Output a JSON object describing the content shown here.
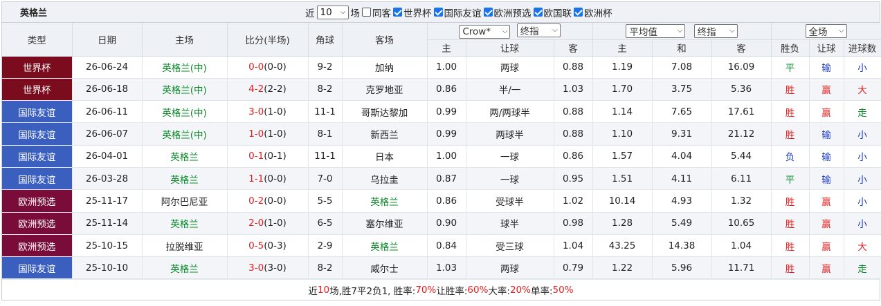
{
  "team_title": "英格兰",
  "filters": {
    "near_label": "近",
    "count_value": "10",
    "unit_label": "场",
    "same_guest": {
      "label": "同客",
      "checked": false
    },
    "comps": [
      {
        "label": "世界杯",
        "checked": true
      },
      {
        "label": "国际友谊",
        "checked": true
      },
      {
        "label": "欧洲预选",
        "checked": true
      },
      {
        "label": "欧国联",
        "checked": true
      },
      {
        "label": "欧洲杯",
        "checked": true
      }
    ]
  },
  "header": {
    "type": "类型",
    "date": "日期",
    "home": "主场",
    "score": "比分(半场)",
    "corner": "角球",
    "away": "客场",
    "company_select": "Crow*",
    "handicap_select1": "终指",
    "avg_select": "平均值",
    "handicap_select2": "终指",
    "scope_select": "全场",
    "sub": {
      "h_home": "主",
      "h_line": "让球",
      "h_away": "客",
      "e_home": "主",
      "e_draw": "和",
      "e_away": "客",
      "r_wl": "胜负",
      "r_hcp": "让球",
      "r_goals": "进球数"
    }
  },
  "colors": {
    "world_cup": "#7a0c1e",
    "friendly": "#3a5fbf",
    "euro_qual": "#7a0c3a"
  },
  "rows": [
    {
      "league": "世界杯",
      "lc": "#7a0c1e",
      "date": "26-06-24",
      "home": "英格兰(中)",
      "home_hl": true,
      "score": "0-0",
      "half": "(0-0)",
      "corner": "9-2",
      "away": "加纳",
      "away_hl": false,
      "h1": "1.00",
      "line": "两球",
      "h2": "0.88",
      "e1": "1.19",
      "e2": "7.08",
      "e3": "16.09",
      "wl": "平",
      "hcp": "输",
      "goals": "小"
    },
    {
      "league": "世界杯",
      "lc": "#7a0c1e",
      "date": "26-06-18",
      "home": "英格兰(中)",
      "home_hl": true,
      "score": "4-2",
      "half": "(2-2)",
      "corner": "8-2",
      "away": "克罗地亚",
      "away_hl": false,
      "h1": "0.86",
      "line": "半/一",
      "h2": "1.03",
      "e1": "1.70",
      "e2": "3.75",
      "e3": "5.36",
      "wl": "胜",
      "hcp": "赢",
      "goals": "大"
    },
    {
      "league": "国际友谊",
      "lc": "#3a5fbf",
      "date": "26-06-11",
      "home": "英格兰(中)",
      "home_hl": true,
      "score": "3-0",
      "half": "(1-0)",
      "corner": "11-1",
      "away": "哥斯达黎加",
      "away_hl": false,
      "h1": "0.99",
      "line": "两/两球半",
      "h2": "0.88",
      "e1": "1.14",
      "e2": "7.65",
      "e3": "17.61",
      "wl": "胜",
      "hcp": "赢",
      "goals": "走"
    },
    {
      "league": "国际友谊",
      "lc": "#3a5fbf",
      "date": "26-06-07",
      "home": "英格兰(中)",
      "home_hl": true,
      "score": "1-0",
      "half": "(1-0)",
      "corner": "8-1",
      "away": "新西兰",
      "away_hl": false,
      "h1": "0.99",
      "line": "两球半",
      "h2": "0.88",
      "e1": "1.10",
      "e2": "9.31",
      "e3": "21.12",
      "wl": "胜",
      "hcp": "输",
      "goals": "小"
    },
    {
      "league": "国际友谊",
      "lc": "#3a5fbf",
      "date": "26-04-01",
      "home": "英格兰",
      "home_hl": true,
      "score": "0-1",
      "half": "(0-1)",
      "corner": "11-1",
      "away": "日本",
      "away_hl": false,
      "h1": "1.00",
      "line": "一球",
      "h2": "0.86",
      "e1": "1.57",
      "e2": "4.04",
      "e3": "5.44",
      "wl": "负",
      "hcp": "输",
      "goals": "小"
    },
    {
      "league": "国际友谊",
      "lc": "#3a5fbf",
      "date": "26-03-28",
      "home": "英格兰",
      "home_hl": true,
      "score": "1-1",
      "half": "(0-0)",
      "corner": "7-0",
      "away": "乌拉圭",
      "away_hl": false,
      "h1": "0.87",
      "line": "一球",
      "h2": "0.95",
      "e1": "1.51",
      "e2": "4.11",
      "e3": "6.11",
      "wl": "平",
      "hcp": "输",
      "goals": "小"
    },
    {
      "league": "欧洲预选",
      "lc": "#7a0c3a",
      "date": "25-11-17",
      "home": "阿尔巴尼亚",
      "home_hl": false,
      "score": "0-2",
      "half": "(0-0)",
      "corner": "5-5",
      "away": "英格兰",
      "away_hl": true,
      "h1": "0.86",
      "line": "受球半",
      "h2": "1.02",
      "e1": "10.14",
      "e2": "4.93",
      "e3": "1.32",
      "wl": "胜",
      "hcp": "赢",
      "goals": "小"
    },
    {
      "league": "欧洲预选",
      "lc": "#7a0c3a",
      "date": "25-11-14",
      "home": "英格兰",
      "home_hl": true,
      "score": "2-0",
      "half": "(1-0)",
      "corner": "6-5",
      "away": "塞尔维亚",
      "away_hl": false,
      "h1": "0.90",
      "line": "球半",
      "h2": "0.98",
      "e1": "1.28",
      "e2": "5.49",
      "e3": "10.65",
      "wl": "胜",
      "hcp": "赢",
      "goals": "小"
    },
    {
      "league": "欧洲预选",
      "lc": "#7a0c3a",
      "date": "25-10-15",
      "home": "拉脱维亚",
      "home_hl": false,
      "score": "0-5",
      "half": "(0-3)",
      "corner": "2-9",
      "away": "英格兰",
      "away_hl": true,
      "h1": "0.84",
      "line": "受三球",
      "h2": "1.04",
      "e1": "43.25",
      "e2": "14.38",
      "e3": "1.04",
      "wl": "胜",
      "hcp": "赢",
      "goals": "大"
    },
    {
      "league": "国际友谊",
      "lc": "#3a5fbf",
      "date": "25-10-10",
      "home": "英格兰",
      "home_hl": true,
      "score": "3-0",
      "half": "(3-0)",
      "corner": "8-2",
      "away": "威尔士",
      "away_hl": false,
      "h1": "1.03",
      "line": "两球",
      "h2": "0.79",
      "e1": "1.22",
      "e2": "5.96",
      "e3": "11.71",
      "wl": "胜",
      "hcp": "赢",
      "goals": "走"
    }
  ],
  "summary": {
    "p1": "近",
    "n_games": "10",
    "p2": "场,胜7平2负1, 胜率:",
    "win_rate": "70%",
    "p3": " 让胜率:",
    "hcp_rate": "60%",
    "p4": " 大率:",
    "big_rate": "20%",
    "p5": " 单率:",
    "odd_rate": "50%"
  }
}
